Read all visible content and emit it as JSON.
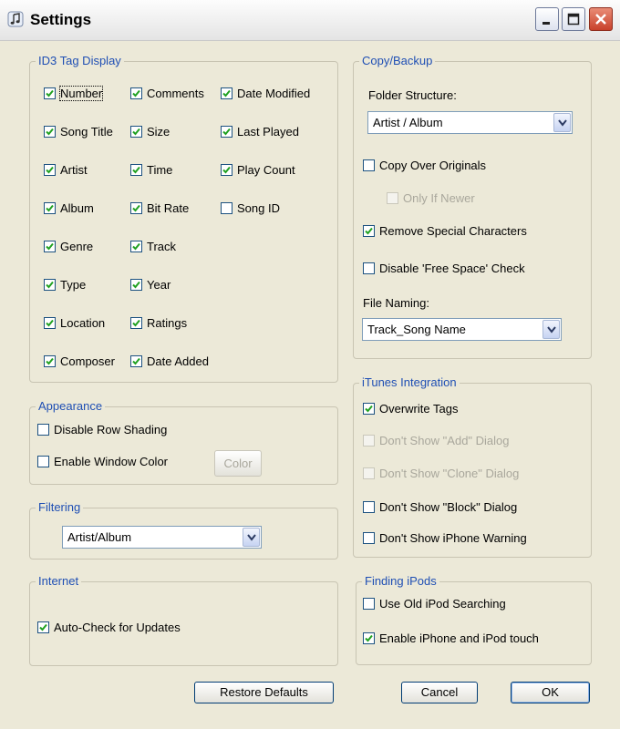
{
  "window": {
    "title": "Settings",
    "icon": "music-note-icon"
  },
  "id3": {
    "legend": "ID3 Tag Display",
    "col1": [
      {
        "label": "Number",
        "checked": true
      },
      {
        "label": "Song Title",
        "checked": true
      },
      {
        "label": "Artist",
        "checked": true
      },
      {
        "label": "Album",
        "checked": true
      },
      {
        "label": "Genre",
        "checked": true
      },
      {
        "label": "Type",
        "checked": true
      },
      {
        "label": "Location",
        "checked": true
      },
      {
        "label": "Composer",
        "checked": true
      }
    ],
    "col2": [
      {
        "label": "Comments",
        "checked": true
      },
      {
        "label": "Size",
        "checked": true
      },
      {
        "label": "Time",
        "checked": true
      },
      {
        "label": "Bit Rate",
        "checked": true
      },
      {
        "label": "Track",
        "checked": true
      },
      {
        "label": "Year",
        "checked": true
      },
      {
        "label": "Ratings",
        "checked": true
      },
      {
        "label": "Date Added",
        "checked": true
      }
    ],
    "col3": [
      {
        "label": "Date Modified",
        "checked": true
      },
      {
        "label": "Last Played",
        "checked": true
      },
      {
        "label": "Play Count",
        "checked": true
      },
      {
        "label": "Song ID",
        "checked": false
      }
    ]
  },
  "appearance": {
    "legend": "Appearance",
    "disable_row_shading": {
      "label": "Disable Row Shading",
      "checked": false
    },
    "enable_window_color": {
      "label": "Enable Window Color",
      "checked": false
    },
    "color_button": "Color"
  },
  "filtering": {
    "legend": "Filtering",
    "selected": "Artist/Album"
  },
  "internet": {
    "legend": "Internet",
    "auto_check": {
      "label": "Auto-Check for Updates",
      "checked": true
    }
  },
  "copy_backup": {
    "legend": "Copy/Backup",
    "folder_structure_label": "Folder Structure:",
    "folder_structure_value": "Artist / Album",
    "copy_over_originals": {
      "label": "Copy Over Originals",
      "checked": false
    },
    "only_if_newer": {
      "label": "Only If Newer",
      "checked": false,
      "enabled": false
    },
    "remove_special": {
      "label": "Remove Special Characters",
      "checked": true
    },
    "disable_free_space": {
      "label": "Disable 'Free Space' Check",
      "checked": false
    },
    "file_naming_label": "File Naming:",
    "file_naming_value": "Track_Song Name"
  },
  "itunes": {
    "legend": "iTunes Integration",
    "overwrite_tags": {
      "label": "Overwrite Tags",
      "checked": true
    },
    "dont_show_add": {
      "label": "Don't Show \"Add\" Dialog",
      "checked": false,
      "enabled": false
    },
    "dont_show_clone": {
      "label": "Don't Show \"Clone\" Dialog",
      "checked": false,
      "enabled": false
    },
    "dont_show_block": {
      "label": "Don't Show \"Block\" Dialog",
      "checked": false
    },
    "dont_show_iphone": {
      "label": "Don't Show iPhone Warning",
      "checked": false
    }
  },
  "finding_ipods": {
    "legend": "Finding iPods",
    "old_search": {
      "label": "Use Old iPod Searching",
      "checked": false
    },
    "enable_iphone": {
      "label": "Enable iPhone and iPod touch",
      "checked": true
    }
  },
  "buttons": {
    "restore": "Restore Defaults",
    "cancel": "Cancel",
    "ok": "OK"
  },
  "colors": {
    "legend_blue": "#1F4FB4",
    "face": "#ECE9D8",
    "check_green": "#21A121"
  }
}
